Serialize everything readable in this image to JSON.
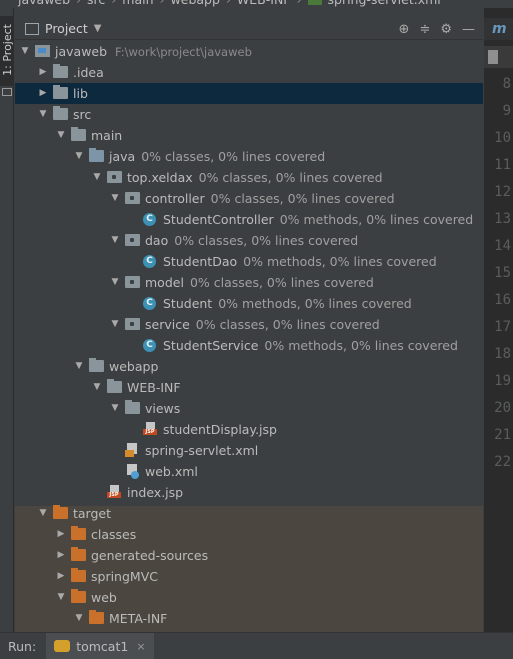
{
  "breadcrumbs": [
    "javaweb",
    "src",
    "main",
    "webapp",
    "WEB-INF",
    "spring-servlet.xml"
  ],
  "left_strip": {
    "tab_label": "1: Project"
  },
  "panel": {
    "title": "Project",
    "tools": [
      "crosshair-icon",
      "collapse-all-icon",
      "gear-icon",
      "hide-icon"
    ]
  },
  "tree": [
    {
      "label": "javaweb",
      "hint": "F:\\work\\project\\javaweb",
      "depth": 0,
      "arrow": "down",
      "icon": "project-folder-icon"
    },
    {
      "label": ".idea",
      "hint": "",
      "depth": 1,
      "arrow": "right",
      "icon": "folder-icon"
    },
    {
      "label": "lib",
      "hint": "",
      "depth": 1,
      "arrow": "right",
      "icon": "folder-icon",
      "selected": true
    },
    {
      "label": "src",
      "hint": "",
      "depth": 1,
      "arrow": "down",
      "icon": "folder-icon"
    },
    {
      "label": "main",
      "hint": "",
      "depth": 2,
      "arrow": "down",
      "icon": "folder-icon"
    },
    {
      "label": "java",
      "hint": "0% classes, 0% lines covered",
      "depth": 3,
      "arrow": "down",
      "icon": "source-folder-icon"
    },
    {
      "label": "top.xeldax",
      "hint": "0% classes, 0% lines covered",
      "depth": 4,
      "arrow": "down",
      "icon": "package-icon"
    },
    {
      "label": "controller",
      "hint": "0% classes, 0% lines covered",
      "depth": 5,
      "arrow": "down",
      "icon": "package-icon"
    },
    {
      "label": "StudentController",
      "hint": "0% methods, 0% lines covered",
      "depth": 6,
      "arrow": "none",
      "icon": "class-icon"
    },
    {
      "label": "dao",
      "hint": "0% classes, 0% lines covered",
      "depth": 5,
      "arrow": "down",
      "icon": "package-icon"
    },
    {
      "label": "StudentDao",
      "hint": "0% methods, 0% lines covered",
      "depth": 6,
      "arrow": "none",
      "icon": "class-icon"
    },
    {
      "label": "model",
      "hint": "0% classes, 0% lines covered",
      "depth": 5,
      "arrow": "down",
      "icon": "package-icon"
    },
    {
      "label": "Student",
      "hint": "0% methods, 0% lines covered",
      "depth": 6,
      "arrow": "none",
      "icon": "class-icon"
    },
    {
      "label": "service",
      "hint": "0% classes, 0% lines covered",
      "depth": 5,
      "arrow": "down",
      "icon": "package-icon"
    },
    {
      "label": "StudentService",
      "hint": "0% methods, 0% lines covered",
      "depth": 6,
      "arrow": "none",
      "icon": "class-icon"
    },
    {
      "label": "webapp",
      "hint": "",
      "depth": 3,
      "arrow": "down",
      "icon": "folder-icon"
    },
    {
      "label": "WEB-INF",
      "hint": "",
      "depth": 4,
      "arrow": "down",
      "icon": "folder-icon"
    },
    {
      "label": "views",
      "hint": "",
      "depth": 5,
      "arrow": "down",
      "icon": "folder-icon"
    },
    {
      "label": "studentDisplay.jsp",
      "hint": "",
      "depth": 6,
      "arrow": "none",
      "icon": "jsp-file-icon"
    },
    {
      "label": "spring-servlet.xml",
      "hint": "",
      "depth": 5,
      "arrow": "none",
      "icon": "xml-file-icon"
    },
    {
      "label": "web.xml",
      "hint": "",
      "depth": 5,
      "arrow": "none",
      "icon": "web-xml-icon"
    },
    {
      "label": "index.jsp",
      "hint": "",
      "depth": 4,
      "arrow": "none",
      "icon": "jsp-file-icon"
    },
    {
      "label": "target",
      "hint": "",
      "depth": 1,
      "arrow": "down",
      "icon": "excluded-folder-icon"
    },
    {
      "label": "classes",
      "hint": "",
      "depth": 2,
      "arrow": "right",
      "icon": "excluded-folder-icon"
    },
    {
      "label": "generated-sources",
      "hint": "",
      "depth": 2,
      "arrow": "right",
      "icon": "excluded-folder-icon"
    },
    {
      "label": "springMVC",
      "hint": "",
      "depth": 2,
      "arrow": "right",
      "icon": "excluded-folder-icon"
    },
    {
      "label": "web",
      "hint": "",
      "depth": 2,
      "arrow": "down",
      "icon": "excluded-folder-icon"
    },
    {
      "label": "META-INF",
      "hint": "",
      "depth": 3,
      "arrow": "down",
      "icon": "excluded-folder-icon"
    }
  ],
  "editor": {
    "tab_glyph": "m",
    "line_numbers": [
      "8",
      "9",
      "10",
      "11",
      "12",
      "13",
      "14",
      "15",
      "16",
      "17",
      "18",
      "19",
      "20",
      "21",
      "22"
    ]
  },
  "runbar": {
    "label": "Run:",
    "tab": "tomcat1",
    "close": "×"
  },
  "colors": {
    "selection": "#0d293e",
    "excluded_bg": "#4b4740",
    "excluded_folder": "#c9702a",
    "class_icon": "#3d91b5"
  }
}
